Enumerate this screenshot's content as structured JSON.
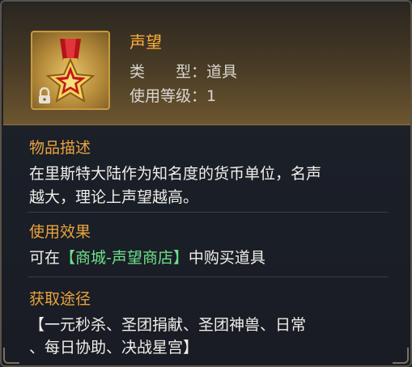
{
  "item": {
    "name": "声望",
    "type_label": "类　　型：",
    "type_value": "道具",
    "level_label": "使用等级：",
    "level_value": "1"
  },
  "description": {
    "title": "物品描述",
    "line1": "在里斯特大陆作为知名度的货币单位，名声",
    "line2": "越大，理论上声望越高。"
  },
  "effect": {
    "title": "使用效果",
    "prefix": "可在",
    "highlight": "【商城-声望商店】",
    "suffix": "中购买道具"
  },
  "source": {
    "title": "获取途径",
    "line1": "【一元秒杀、圣团捐献、圣团神兽、日常",
    "line2": "、每日协助、决战星宫】"
  },
  "icons": {
    "item": "star-medal-icon",
    "badge": "lock-icon"
  },
  "colors": {
    "name": "#ffb037",
    "section_title": "#e8a33c",
    "highlight": "#6fe08b",
    "text": "#efeee9"
  }
}
